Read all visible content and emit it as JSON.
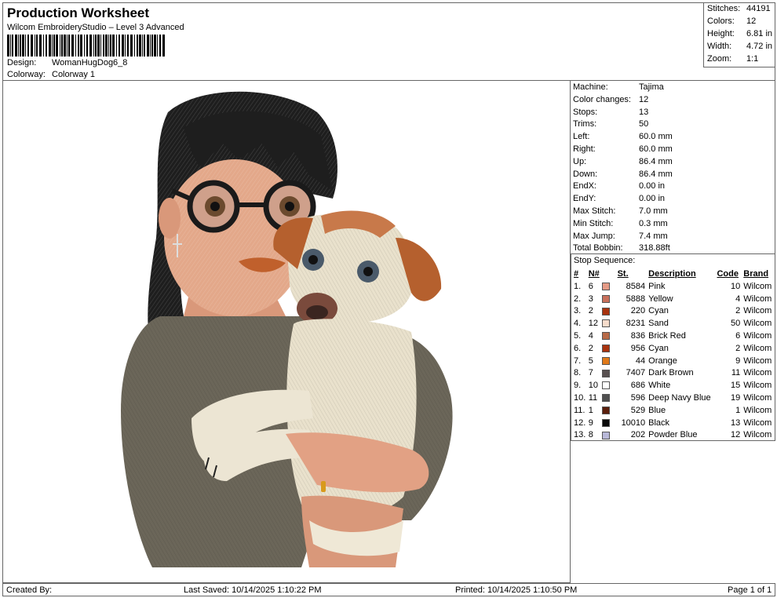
{
  "header": {
    "title": "Production Worksheet",
    "software": "Wilcom EmbroideryStudio – Level 3 Advanced",
    "design_label": "Design:",
    "design_value": "WomanHugDog6_8",
    "colorway_label": "Colorway:",
    "colorway_value": "Colorway 1"
  },
  "stats": {
    "stitches_label": "Stitches:",
    "stitches": "44191",
    "colors_label": "Colors:",
    "colors": "12",
    "height_label": "Height:",
    "height": "6.81 in",
    "width_label": "Width:",
    "width": "4.72 in",
    "zoom_label": "Zoom:",
    "zoom": "1:1"
  },
  "machine_info": [
    {
      "label": "Machine:",
      "value": "Tajima"
    },
    {
      "label": "Color changes:",
      "value": "12"
    },
    {
      "label": "Stops:",
      "value": "13"
    },
    {
      "label": "Trims:",
      "value": "50"
    },
    {
      "label": "Left:",
      "value": "60.0 mm"
    },
    {
      "label": "Right:",
      "value": "60.0 mm"
    },
    {
      "label": "Up:",
      "value": "86.4 mm"
    },
    {
      "label": "Down:",
      "value": "86.4 mm"
    },
    {
      "label": "EndX:",
      "value": "0.00 in"
    },
    {
      "label": "EndY:",
      "value": "0.00 in"
    },
    {
      "label": "Max Stitch:",
      "value": "7.0 mm"
    },
    {
      "label": "Min Stitch:",
      "value": "0.3 mm"
    },
    {
      "label": "Max Jump:",
      "value": "7.4 mm"
    },
    {
      "label": "Total Bobbin:",
      "value": "318.88ft"
    }
  ],
  "stop_sequence": {
    "title": "Stop Sequence:",
    "columns": {
      "num": "#",
      "n": "N#",
      "st": "St.",
      "desc": "Description",
      "code": "Code",
      "brand": "Brand"
    },
    "rows": [
      {
        "num": "1.",
        "n": "6",
        "color": "#e49a86",
        "st": "8584",
        "desc": "Pink",
        "code": "10",
        "brand": "Wilcom"
      },
      {
        "num": "2.",
        "n": "3",
        "color": "#c8705c",
        "st": "5888",
        "desc": "Yellow",
        "code": "4",
        "brand": "Wilcom"
      },
      {
        "num": "3.",
        "n": "2",
        "color": "#a8320e",
        "st": "220",
        "desc": "Cyan",
        "code": "2",
        "brand": "Wilcom"
      },
      {
        "num": "4.",
        "n": "12",
        "color": "#f6dccb",
        "st": "8231",
        "desc": "Sand",
        "code": "50",
        "brand": "Wilcom"
      },
      {
        "num": "5.",
        "n": "4",
        "color": "#b86a48",
        "st": "836",
        "desc": "Brick Red",
        "code": "6",
        "brand": "Wilcom"
      },
      {
        "num": "6.",
        "n": "2",
        "color": "#a8320e",
        "st": "956",
        "desc": "Cyan",
        "code": "2",
        "brand": "Wilcom"
      },
      {
        "num": "7.",
        "n": "5",
        "color": "#e07a1a",
        "st": "44",
        "desc": "Orange",
        "code": "9",
        "brand": "Wilcom"
      },
      {
        "num": "8.",
        "n": "7",
        "color": "#585050",
        "st": "7407",
        "desc": "Dark Brown",
        "code": "11",
        "brand": "Wilcom"
      },
      {
        "num": "9.",
        "n": "10",
        "color": "#ffffff",
        "st": "686",
        "desc": "White",
        "code": "15",
        "brand": "Wilcom"
      },
      {
        "num": "10.",
        "n": "11",
        "color": "#505050",
        "st": "596",
        "desc": "Deep Navy Blue",
        "code": "19",
        "brand": "Wilcom"
      },
      {
        "num": "11.",
        "n": "1",
        "color": "#5a1e0c",
        "st": "529",
        "desc": "Blue",
        "code": "1",
        "brand": "Wilcom"
      },
      {
        "num": "12.",
        "n": "9",
        "color": "#0a0a0a",
        "st": "10010",
        "desc": "Black",
        "code": "13",
        "brand": "Wilcom"
      },
      {
        "num": "13.",
        "n": "8",
        "color": "#b8b8d8",
        "st": "202",
        "desc": "Powder Blue",
        "code": "12",
        "brand": "Wilcom"
      }
    ]
  },
  "footer": {
    "created_by": "Created By:",
    "last_saved": "Last Saved: 10/14/2025 1:10:22 PM",
    "printed": "Printed: 10/14/2025 1:10:50 PM",
    "page": "Page 1 of 1"
  }
}
